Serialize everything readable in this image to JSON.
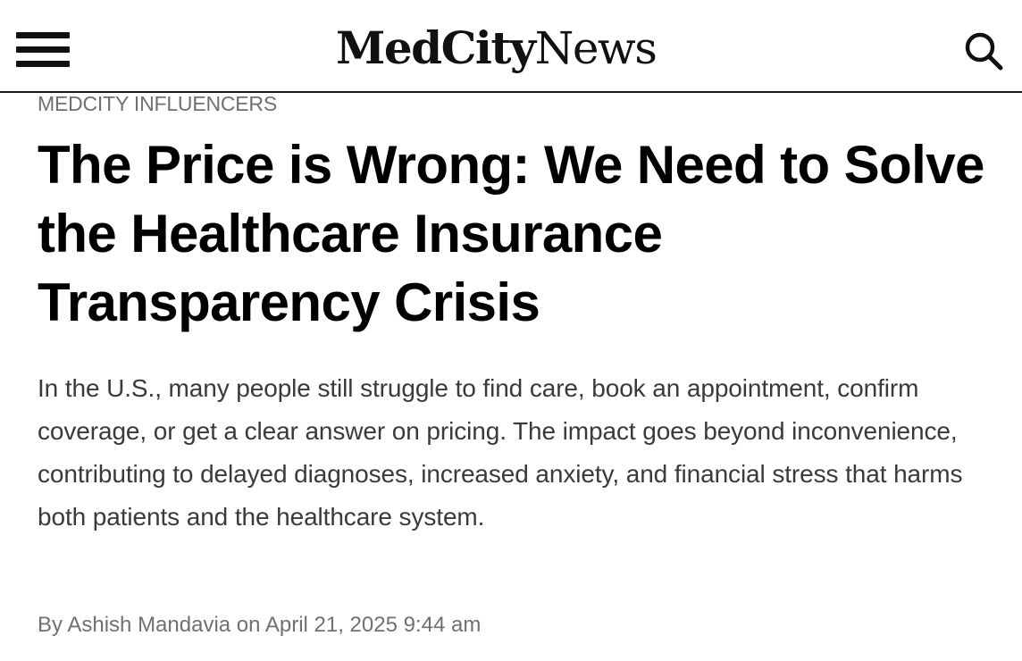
{
  "header": {
    "logo_bold": "MedCity",
    "logo_regular": "News"
  },
  "article": {
    "category": "MEDCITY INFLUENCERS",
    "title": "The Price is Wrong: We Need to Solve the Healthcare Insurance Transparency Crisis",
    "summary": "In the U.S., many people still struggle to find care, book an appointment, confirm coverage, or get a clear answer on pricing. The impact goes beyond inconvenience, contributing to delayed diagnoses, increased anxiety, and financial stress that harms both patients and the healthcare system.",
    "byline": {
      "by_prefix": "By",
      "author": "Ashish Mandavia",
      "on_word": "on",
      "date": "April 21, 2025 9:44 am"
    }
  },
  "icons": {
    "menu": "hamburger-menu-icon",
    "search": "search-icon"
  },
  "colors": {
    "text": "#000000",
    "muted": "#707070",
    "summary": "#3a3a3a",
    "rule": "#1a1a1a"
  }
}
